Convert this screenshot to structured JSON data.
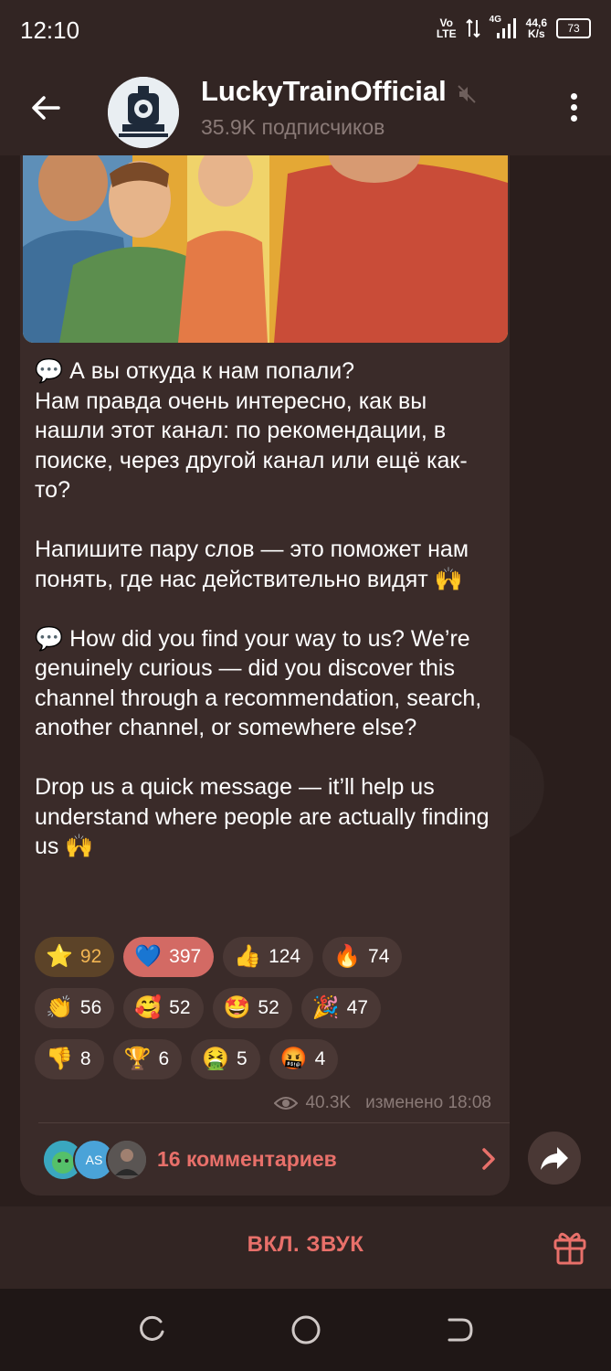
{
  "status_bar": {
    "time": "12:10",
    "net_lte_top": "Vo",
    "net_lte_bottom": "LTE",
    "net_4g": "4G",
    "speed_top": "44,6",
    "speed_bottom": "K/s",
    "battery": "73"
  },
  "header": {
    "title": "LuckyTrainOfficial",
    "subtitle": "35.9K подписчиков"
  },
  "post": {
    "text": "💬 А вы откуда к нам попали?\nНам правда очень интересно, как вы нашли этот канал: по рекомендации, в поиске, через другой канал или ещё как-то?\n\nНапишите пару слов — это поможет нам понять, где нас действительно видят 🙌\n\n💬 How did you find your way to us? We’re genuinely curious — did you discover this channel through a recommendation, search, another channel, or somewhere else?\n\nDrop us a quick message — it’ll help us understand where people are actually finding us 🙌",
    "reactions": [
      {
        "emoji": "⭐",
        "count": "92"
      },
      {
        "emoji": "💙",
        "count": "397"
      },
      {
        "emoji": "👍",
        "count": "124"
      },
      {
        "emoji": "🔥",
        "count": "74"
      },
      {
        "emoji": "👏",
        "count": "56"
      },
      {
        "emoji": "🥰",
        "count": "52"
      },
      {
        "emoji": "🤩",
        "count": "52"
      },
      {
        "emoji": "🎉",
        "count": "47"
      },
      {
        "emoji": "👎",
        "count": "8"
      },
      {
        "emoji": "🏆",
        "count": "6"
      },
      {
        "emoji": "🤮",
        "count": "5"
      },
      {
        "emoji": "🤬",
        "count": "4"
      }
    ],
    "views": "40.3K",
    "edited": "изменено 18:08",
    "comments_label": "16 комментариев",
    "comment_avatar_initials": "AS"
  },
  "bottom": {
    "sound_button": "ВКЛ. ЗВУК"
  },
  "colors": {
    "accent": "#e8706a",
    "bubble": "#3a2b29",
    "header": "#322523"
  }
}
